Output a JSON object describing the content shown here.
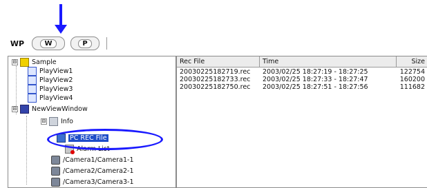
{
  "toolbar": {
    "tabs": [
      {
        "label": "WP"
      },
      {
        "label": "W"
      },
      {
        "label": "P"
      }
    ]
  },
  "tree": {
    "nodes": [
      {
        "label": "Sample",
        "icon": "folder-icon",
        "expander": "⊟"
      },
      {
        "label": "PlayView1",
        "icon": "view-icon"
      },
      {
        "label": "PlayView2",
        "icon": "view-icon"
      },
      {
        "label": "PlayView3",
        "icon": "view-icon"
      },
      {
        "label": "PlayView4",
        "icon": "view-icon"
      },
      {
        "label": "NewViewWindow",
        "icon": "window-icon",
        "expander": "⊟"
      },
      {
        "label": "Info",
        "icon": "info-icon",
        "expander": "⊟"
      },
      {
        "label": "PC REC File",
        "icon": "pc-rec-file-icon",
        "selected": true
      },
      {
        "label": "Alarm List",
        "icon": "alarm-list-icon"
      },
      {
        "label": "/Camera1/Camera1-1",
        "icon": "camera-icon"
      },
      {
        "label": "/Camera2/Camera2-1",
        "icon": "camera-icon"
      },
      {
        "label": "/Camera3/Camera3-1",
        "icon": "camera-icon"
      }
    ]
  },
  "list": {
    "columns": [
      "Rec File",
      "Time",
      "Size"
    ],
    "rows": [
      [
        "20030225182719.rec",
        "2003/02/25 18:27:19 - 18:27:25",
        "122754"
      ],
      [
        "20030225182733.rec",
        "2003/02/25 18:27:33 - 18:27:47",
        "160200"
      ],
      [
        "20030225182750.rec",
        "2003/02/25 18:27:51 - 18:27:56",
        "111682"
      ]
    ]
  },
  "annotation_color": "#1a1aff"
}
